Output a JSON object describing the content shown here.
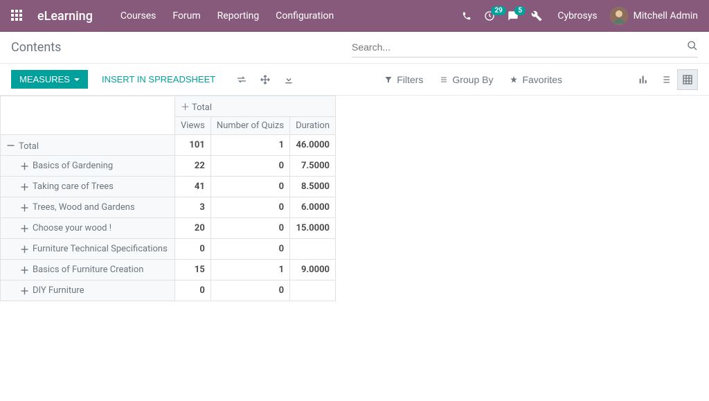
{
  "brand": "eLearning",
  "nav": {
    "courses": "Courses",
    "forum": "Forum",
    "reporting": "Reporting",
    "configuration": "Configuration"
  },
  "badges": {
    "activities": "29",
    "messages": "5"
  },
  "company": "Cybrosys",
  "user": "Mitchell Admin",
  "page_title": "Contents",
  "search": {
    "placeholder": "Search..."
  },
  "toolbar": {
    "measures": "MEASURES",
    "spreadsheet": "INSERT IN SPREADSHEET",
    "filters": "Filters",
    "groupby": "Group By",
    "favorites": "Favorites"
  },
  "pivot": {
    "total_label": "Total",
    "columns": [
      "Views",
      "Number of Quizs",
      "Duration"
    ],
    "total_row": {
      "label": "Total",
      "views": "101",
      "quizs": "1",
      "duration": "46.0000"
    },
    "rows": [
      {
        "label": "Basics of Gardening",
        "views": "22",
        "quizs": "0",
        "duration": "7.5000"
      },
      {
        "label": "Taking care of Trees",
        "views": "41",
        "quizs": "0",
        "duration": "8.5000"
      },
      {
        "label": "Trees, Wood and Gardens",
        "views": "3",
        "quizs": "0",
        "duration": "6.0000"
      },
      {
        "label": "Choose your wood !",
        "views": "20",
        "quizs": "0",
        "duration": "15.0000"
      },
      {
        "label": "Furniture Technical Specifications",
        "views": "0",
        "quizs": "0",
        "duration": ""
      },
      {
        "label": "Basics of Furniture Creation",
        "views": "15",
        "quizs": "1",
        "duration": "9.0000"
      },
      {
        "label": "DIY Furniture",
        "views": "0",
        "quizs": "0",
        "duration": ""
      }
    ]
  },
  "chart_data": {
    "type": "table",
    "title": "Contents pivot",
    "columns": [
      "Views",
      "Number of Quizs",
      "Duration"
    ],
    "categories": [
      "Basics of Gardening",
      "Taking care of Trees",
      "Trees, Wood and Gardens",
      "Choose your wood !",
      "Furniture Technical Specifications",
      "Basics of Furniture Creation",
      "DIY Furniture"
    ],
    "series": [
      {
        "name": "Views",
        "values": [
          22,
          41,
          3,
          20,
          0,
          15,
          0
        ]
      },
      {
        "name": "Number of Quizs",
        "values": [
          0,
          0,
          0,
          0,
          0,
          1,
          0
        ]
      },
      {
        "name": "Duration",
        "values": [
          7.5,
          8.5,
          6.0,
          15.0,
          null,
          9.0,
          null
        ]
      }
    ],
    "totals": {
      "Views": 101,
      "Number of Quizs": 1,
      "Duration": 46.0
    }
  }
}
